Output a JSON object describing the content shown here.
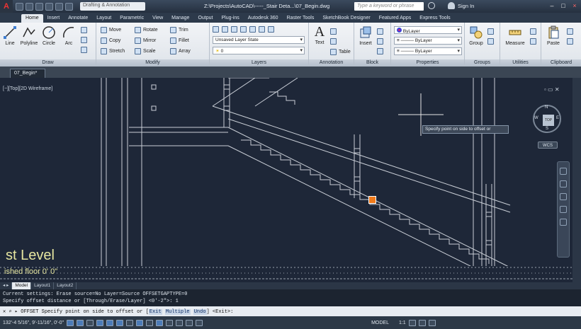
{
  "titlebar": {
    "app_letter": "A",
    "workspace": "Drafting & Annotation",
    "title": "Z:\\Projects\\AutoCAD\\-----_Stair Deta...\\07_Begin.dwg",
    "search_placeholder": "Type a keyword or phrase",
    "sign_in": "Sign In"
  },
  "tabs": [
    "Home",
    "Insert",
    "Annotate",
    "Layout",
    "Parametric",
    "View",
    "Manage",
    "Output",
    "Plug-ins",
    "Autodesk 360",
    "Raster Tools",
    "SketchBook Designer",
    "Featured Apps",
    "Express Tools"
  ],
  "ribbon": {
    "draw": {
      "title": "Draw",
      "line": "Line",
      "polyline": "Polyline",
      "circle": "Circle",
      "arc": "Arc"
    },
    "modify": {
      "title": "Modify",
      "move": "Move",
      "rotate": "Rotate",
      "trim": "Trim",
      "copy": "Copy",
      "mirror": "Mirror",
      "fillet": "Fillet",
      "stretch": "Stretch",
      "scale": "Scale",
      "array": "Array"
    },
    "layers": {
      "title": "Layers",
      "layer_state": "Unsaved Layer State",
      "current_layer": "0"
    },
    "annotation": {
      "title": "Annotation",
      "text": "Text",
      "table": "Table"
    },
    "block": {
      "title": "Block",
      "insert": "Insert"
    },
    "properties": {
      "title": "Properties",
      "color": "ByLayer",
      "linetype": "ByLayer",
      "lineweight": "ByLayer"
    },
    "groups": {
      "title": "Groups",
      "group": "Group"
    },
    "utilities": {
      "title": "Utilities",
      "measure": "Measure"
    },
    "clipboard": {
      "title": "Clipboard",
      "paste": "Paste"
    }
  },
  "doc_tab": "07_Begin*",
  "viewport": {
    "label": "[−][Top][2D Wireframe]",
    "tooltip": "Specify point on side to offset or",
    "level_text": "st Level",
    "level_sub": "ished floor   0' 0\"",
    "viewcube": {
      "face": "TOP",
      "n": "N",
      "s": "S",
      "e": "E",
      "w": "W",
      "wcs": "WCS"
    }
  },
  "layout_tabs": [
    "Model",
    "Layout1",
    "Layout2"
  ],
  "command": {
    "history1": "Current settings: Erase source=No  Layer=Source  OFFSETGAPTYPE=0",
    "history2": "Specify offset distance or [Through/Erase/Layer] <0'-2\">: 1",
    "prompt": "OFFSET Specify point on side to offset or [",
    "opt1": "Exit",
    "opt2": "Multiple",
    "opt3": "Undo",
    "prompt_end": "] <Exit>:"
  },
  "status": {
    "coords": "132'-4 5/16\", 9'-11/16\", 0'-0\"",
    "space": "MODEL",
    "scale": "1:1"
  }
}
